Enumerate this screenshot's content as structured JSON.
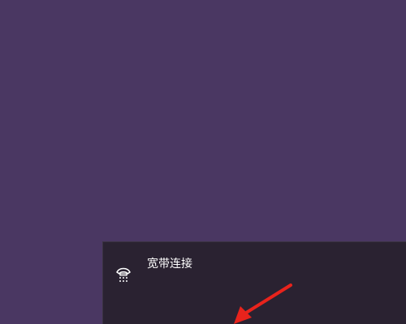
{
  "desktop": {
    "background_color": "#4a3762"
  },
  "network_flyout": {
    "background_color": "#2a2231",
    "items": [
      {
        "label": "宽带连接",
        "icon": "dialup-phone-icon"
      }
    ]
  },
  "annotation": {
    "type": "arrow",
    "color": "#e8231c",
    "points_to": "network-flyout-bottom"
  }
}
